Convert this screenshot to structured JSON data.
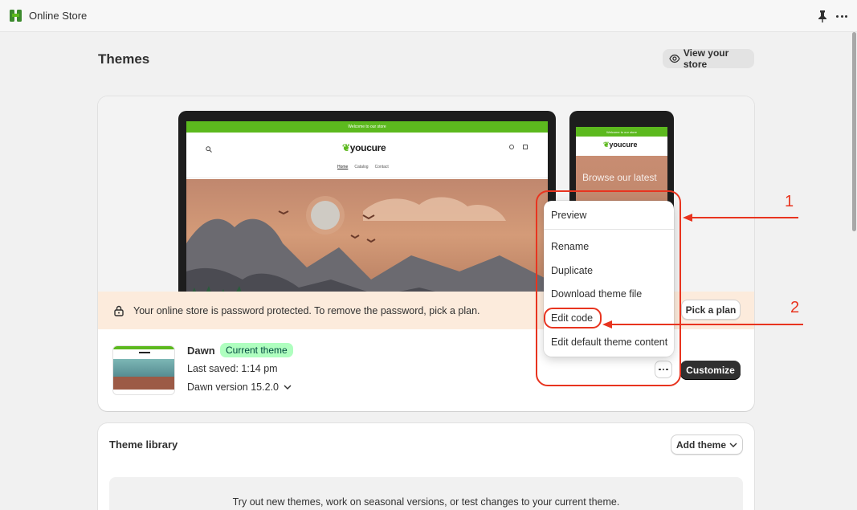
{
  "app": {
    "title": "Online Store"
  },
  "page": {
    "title": "Themes",
    "view_store_label": "View your store"
  },
  "preview": {
    "desktop": {
      "announcement": "Welcome to our store",
      "logo": "youcure",
      "nav": [
        "Home",
        "Catalog",
        "Contact"
      ]
    },
    "mobile": {
      "announcement": "Welcome to our store",
      "logo": "youcure",
      "hero_text": "Browse our latest"
    }
  },
  "banner": {
    "text": "Your online store is password protected. To remove the password, pick a plan.",
    "button": "Pick a plan"
  },
  "current_theme": {
    "name": "Dawn",
    "badge": "Current theme",
    "last_saved": "Last saved: 1:14 pm",
    "version": "Dawn version 15.2.0",
    "customize_label": "Customize"
  },
  "menu": {
    "items": [
      "Preview",
      "Rename",
      "Duplicate",
      "Download theme file",
      "Edit code",
      "Edit default theme content"
    ]
  },
  "library": {
    "title": "Theme library",
    "add_theme_label": "Add theme",
    "empty_text": "Try out new themes, work on seasonal versions, or test changes to your current theme."
  },
  "annotations": {
    "label_1": "1",
    "label_2": "2",
    "color": "#e8341f"
  },
  "colors": {
    "accent_green": "#5cb91e",
    "badge_bg": "#affebf",
    "banner_bg": "#fcebdc",
    "primary_button": "#303030"
  }
}
